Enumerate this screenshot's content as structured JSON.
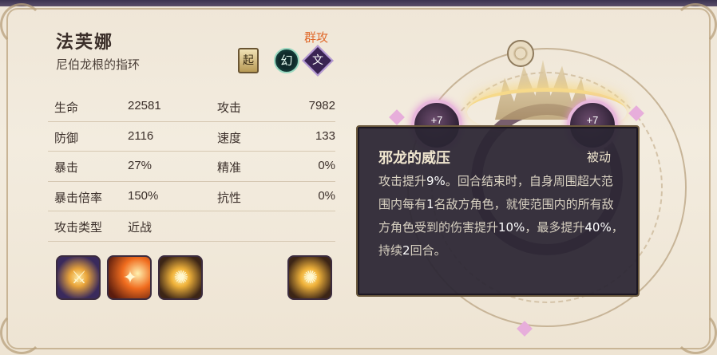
{
  "character": {
    "name": "法芙娜",
    "subtitle": "尼伯龙根的指环",
    "attack_tag": "群攻",
    "badges": {
      "book": "起",
      "circle": "幻",
      "diamond": "文"
    }
  },
  "stats": [
    {
      "label": "生命",
      "value": "22581",
      "label2": "攻击",
      "value2": "7982"
    },
    {
      "label": "防御",
      "value": "2116",
      "label2": "速度",
      "value2": "133"
    },
    {
      "label": "暴击",
      "value": "27%",
      "label2": "精准",
      "value2": "0%"
    },
    {
      "label": "暴击倍率",
      "value": "150%",
      "label2": "抗性",
      "value2": "0%"
    },
    {
      "label": "攻击类型",
      "value": "近战",
      "label2": "",
      "value2": ""
    }
  ],
  "skills": [
    {
      "icon": "axe-slash-icon"
    },
    {
      "icon": "fire-slash-icon"
    },
    {
      "icon": "dragon-aura-icon"
    },
    {
      "icon": "dragon-aura-passive-icon"
    }
  ],
  "gems": [
    {
      "label": "+7"
    },
    {
      "label": "+7"
    }
  ],
  "tooltip": {
    "title": "邪龙的威压",
    "type": "被动",
    "body_parts": [
      "攻击提升",
      "9%",
      "。回合结束时，自身周围超大范围内每有",
      "1",
      "名敌方角色，就使范围内的所有敌方角色受到的伤害提升",
      "10%",
      "，最多提升",
      "40%",
      "，持续",
      "2",
      "回合。"
    ]
  },
  "colors": {
    "attack_tag": "#e06a2c",
    "tooltip_bg": "#2c2634",
    "parchment": "#f3ecdf"
  }
}
